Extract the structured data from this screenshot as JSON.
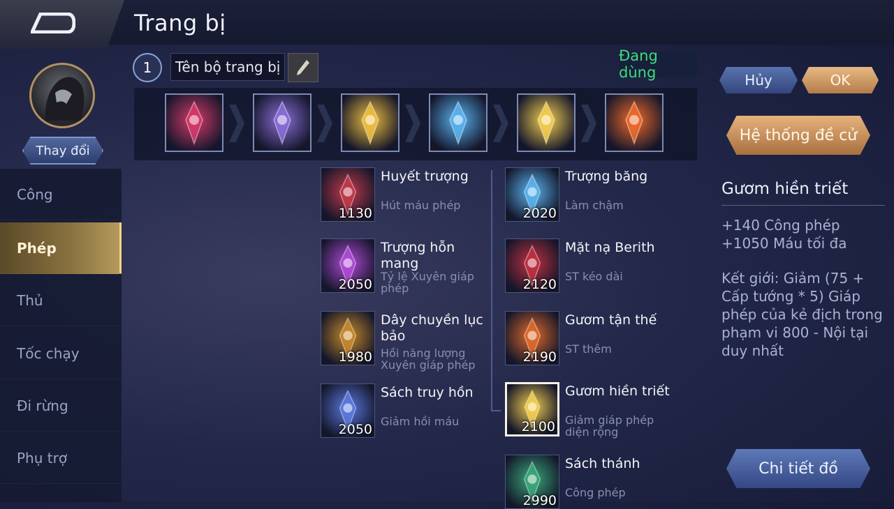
{
  "header": {
    "title": "Trang bị"
  },
  "hero": {
    "change_label": "Thay đổi"
  },
  "build_set": {
    "number": "1",
    "name": "Tên bộ trang bị",
    "status": "Đang dùng"
  },
  "build_slots": [
    {
      "icon": "ruby-amulet-icon",
      "color": "#d63a6a"
    },
    {
      "icon": "boots-icon",
      "color": "#8a6fd8"
    },
    {
      "icon": "golden-crown-icon",
      "color": "#f0c040"
    },
    {
      "icon": "ice-staff-icon",
      "color": "#5ab4f0"
    },
    {
      "icon": "golden-sword-icon",
      "color": "#f5d050"
    },
    {
      "icon": "flame-orb-icon",
      "color": "#f06a2a"
    }
  ],
  "actions": {
    "cancel": "Hủy",
    "ok": "OK",
    "suggest": "Hệ thống đề cử",
    "detail": "Chi tiết đồ"
  },
  "categories": [
    {
      "label": "Công",
      "active": false
    },
    {
      "label": "Phép",
      "active": true
    },
    {
      "label": "Thủ",
      "active": false
    },
    {
      "label": "Tốc chạy",
      "active": false
    },
    {
      "label": "Đi rừng",
      "active": false
    },
    {
      "label": "Phụ trợ",
      "active": false
    }
  ],
  "items_left": [
    {
      "name": "Huyết trượng",
      "desc": "Hút máu phép",
      "price": "1130",
      "icon": "blood-staff-icon",
      "color": "#c23a4a"
    },
    {
      "name": "Trượng hỗn mang",
      "desc": "Tỷ lệ Xuyên giáp phép",
      "price": "2050",
      "icon": "chaos-staff-icon",
      "color": "#b04ad8"
    },
    {
      "name": "Dây chuyền lục bảo",
      "desc": "Hồi năng lượng Xuyên giáp phép",
      "price": "1980",
      "icon": "emerald-necklace-icon",
      "color": "#c88a2a"
    },
    {
      "name": "Sách truy hồn",
      "desc": "Giảm hồi máu",
      "price": "2050",
      "icon": "soul-book-icon",
      "color": "#5a7ae0"
    }
  ],
  "items_right": [
    {
      "name": "Trượng băng",
      "desc": "Làm chậm",
      "price": "2020",
      "icon": "ice-staff-icon",
      "color": "#5ab4f0",
      "selected": false
    },
    {
      "name": "Mặt nạ Berith",
      "desc": "ST kéo dài",
      "price": "2120",
      "icon": "berith-mask-icon",
      "color": "#c03040",
      "selected": false
    },
    {
      "name": "Gươm tận thế",
      "desc": "ST thêm",
      "price": "2190",
      "icon": "apocalypse-sword-icon",
      "color": "#e06a2a",
      "selected": false
    },
    {
      "name": "Gươm hiền triết",
      "desc": "Giảm giáp phép diện rộng",
      "price": "2100",
      "icon": "golden-sword-icon",
      "color": "#f5d050",
      "selected": true
    },
    {
      "name": "Sách thánh",
      "desc": "Công phép",
      "price": "2990",
      "icon": "holy-book-icon",
      "color": "#3aa87a",
      "selected": false
    }
  ],
  "detail": {
    "title": "Gươm hiền triết",
    "stat_1": "+140 Công phép",
    "stat_2": "+1050 Máu tối đa",
    "description": "Kết giới: Giảm (75 + Cấp tướng * 5) Giáp phép của kẻ địch trong phạm vi 800 - Nội tại duy nhất"
  }
}
